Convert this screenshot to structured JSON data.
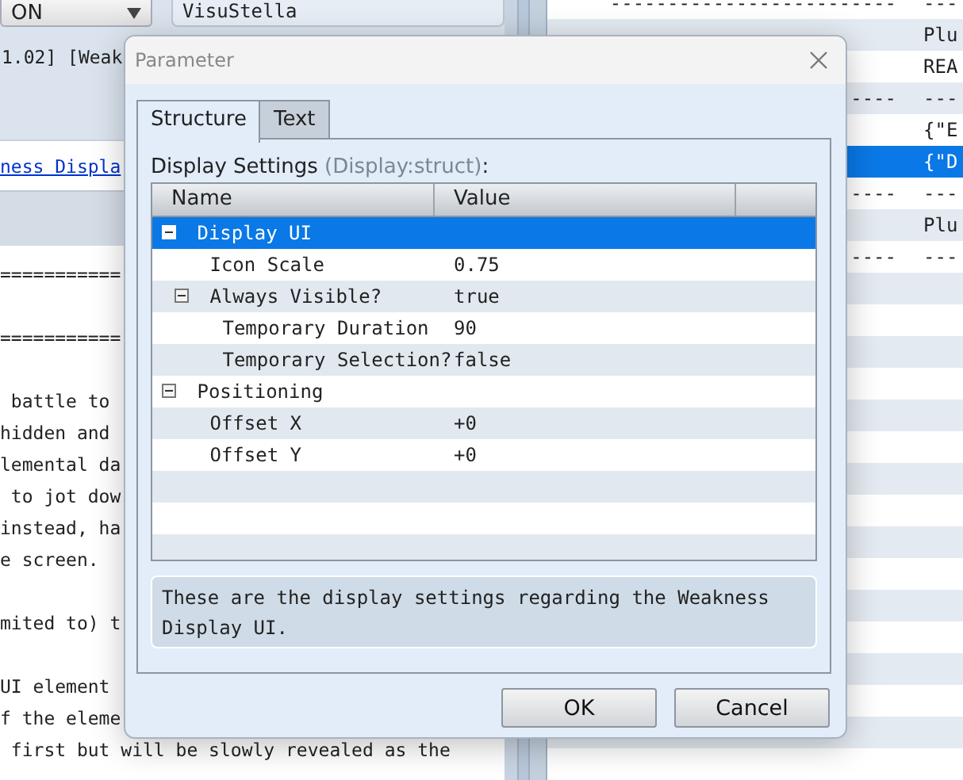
{
  "background": {
    "mode_dropdown": {
      "value": "ON"
    },
    "author_field": {
      "value": "VisuStella"
    },
    "help_heading": "1.02] [Weak",
    "help_link": "ness Displa",
    "help_blocks": [
      [
        "==========="
      ],
      [
        "==========="
      ],
      [
        " battle to",
        "hidden and",
        "lemental da",
        " to jot dow",
        "instead, ha",
        "e screen."
      ],
      [
        "mited to) t"
      ],
      [
        "UI element",
        "f the eleme",
        " first but will be slowly revealed as the"
      ]
    ],
    "list_rows": [
      {
        "column_1": "-------------------------",
        "column_2": "---",
        "selected": false
      },
      {
        "column_2": "Plu",
        "selected": false
      },
      {
        "column_2": "REA",
        "selected": false
      },
      {
        "column_1": "----",
        "column_2": "---",
        "selected": false
      },
      {
        "column_2": "{\"E",
        "selected": false
      },
      {
        "column_2": "{\"D",
        "selected": true
      },
      {
        "column_1": "----",
        "column_2": "---",
        "selected": false
      },
      {
        "column_2": "Plu",
        "selected": false
      },
      {
        "column_1": "----",
        "column_2": "---",
        "selected": false
      }
    ]
  },
  "dialog": {
    "title": "Parameter",
    "tabs": [
      {
        "label": "Structure",
        "selected": true
      },
      {
        "label": "Text",
        "selected": false
      }
    ],
    "field_label": "Display Settings **(Display:struct)**:",
    "columns": [
      "Name",
      "Value"
    ],
    "tree": [
      {
        "label": "Display UI",
        "expanded": true,
        "selected": true,
        "children": [
          {
            "label": "Icon Scale",
            "value": "0.75",
            "selected": false
          },
          {
            "label": "Always Visible?",
            "value": "true",
            "expanded": true,
            "selected": false,
            "children": [
              {
                "label": "Temporary Duration",
                "value": "90",
                "selected": false
              },
              {
                "label": "Temporary Selection?",
                "value": "false",
                "selected": false
              }
            ]
          }
        ]
      },
      {
        "label": "Positioning",
        "expanded": true,
        "selected": false,
        "children": [
          {
            "label": "Offset X",
            "value": "+0",
            "selected": false
          },
          {
            "label": "Offset Y",
            "value": "+0",
            "selected": false
          }
        ]
      }
    ],
    "description": "These are the display settings regarding the Weakness Display UI.",
    "buttons": [
      "OK",
      "Cancel"
    ]
  }
}
